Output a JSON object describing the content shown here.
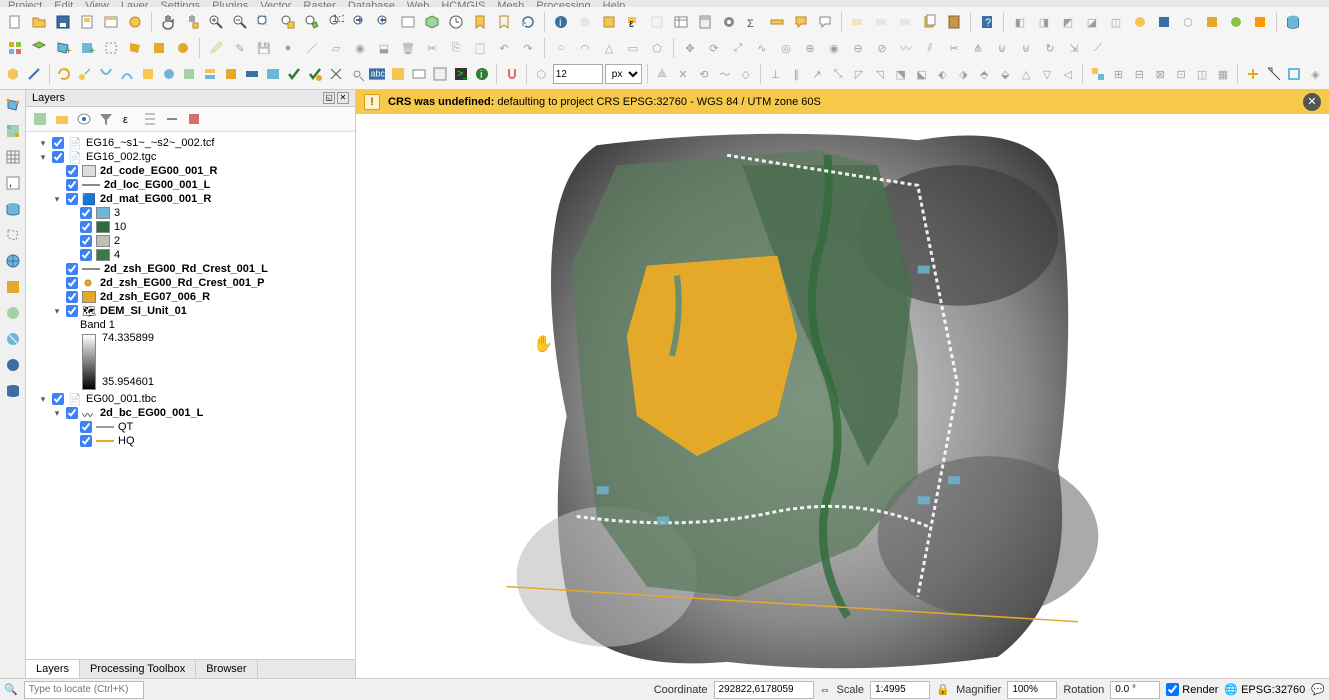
{
  "menu": {
    "items": [
      "Project",
      "Edit",
      "View",
      "Layer",
      "Settings",
      "Plugins",
      "Vector",
      "Raster",
      "Database",
      "Web",
      "HCMGIS",
      "Mesh",
      "Processing",
      "Help"
    ]
  },
  "spin_value": "12",
  "unit": "px",
  "panel": {
    "title": "Layers",
    "tree": {
      "g1": {
        "label": "EG16_~s1~_~s2~_002.tcf"
      },
      "g2": {
        "label": "EG16_002.tgc"
      },
      "l_code": {
        "label": "2d_code_EG00_001_R"
      },
      "l_loc": {
        "label": "2d_loc_EG00_001_L"
      },
      "l_mat": {
        "label": "2d_mat_EG00_001_R"
      },
      "mat3": {
        "label": "3",
        "color": "#6fb7d6"
      },
      "mat10": {
        "label": "10",
        "color": "#2f6b3a"
      },
      "mat2": {
        "label": "2",
        "color": "#b8c2b8"
      },
      "mat4": {
        "label": "4",
        "color": "#3b7a4a"
      },
      "l_zsh1": {
        "label": "2d_zsh_EG00_Rd_Crest_001_L"
      },
      "l_zsh2": {
        "label": "2d_zsh_EG00_Rd_Crest_001_P"
      },
      "l_zsh3": {
        "label": "2d_zsh_EG07_006_R",
        "color": "#e5a92a"
      },
      "l_dem": {
        "label": "DEM_SI_Unit_01"
      },
      "band": {
        "label": "Band 1",
        "max": "74.335899",
        "min": "35.954601"
      },
      "g3": {
        "label": "EG00_001.tbc"
      },
      "l_bc": {
        "label": "2d_bc_EG00_001_L"
      },
      "bc_qt": {
        "label": "QT",
        "color": "#9aa0a6"
      },
      "bc_hq": {
        "label": "HQ",
        "color": "#e5a92a"
      }
    },
    "tabs": {
      "layers": "Layers",
      "toolbox": "Processing Toolbox",
      "browser": "Browser"
    }
  },
  "warning": {
    "bold": "CRS was undefined:",
    "rest": "defaulting to project CRS EPSG:32760 - WGS 84 / UTM zone 60S"
  },
  "status": {
    "locator_placeholder": "Type to locate (Ctrl+K)",
    "coord_label": "Coordinate",
    "coord_value": "292822,6178059",
    "scale_label": "Scale",
    "scale_value": "1:4995",
    "mag_label": "Magnifier",
    "mag_value": "100%",
    "rot_label": "Rotation",
    "rot_value": "0.0 °",
    "render_label": "Render",
    "epsg": "EPSG:32760"
  }
}
